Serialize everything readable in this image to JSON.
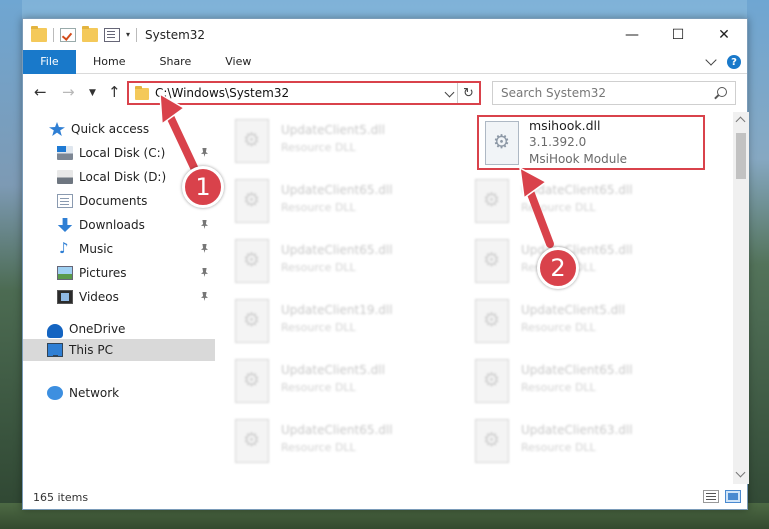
{
  "window": {
    "title": "System32",
    "controls": {
      "minimize": "—",
      "maximize": "☐",
      "close": "✕"
    }
  },
  "ribbon": {
    "tabs": [
      "File",
      "Home",
      "Share",
      "View"
    ]
  },
  "address": {
    "path": "C:\\Windows\\System32",
    "search_placeholder": "Search System32"
  },
  "nav": {
    "quick_access": "Quick access",
    "items": [
      {
        "label": "Local Disk (C:)",
        "icon": "local-disk-icon"
      },
      {
        "label": "Local Disk (D:)",
        "icon": "local-disk-icon"
      },
      {
        "label": "Documents",
        "icon": "documents-icon"
      },
      {
        "label": "Downloads",
        "icon": "downloads-icon"
      },
      {
        "label": "Music",
        "icon": "music-icon"
      },
      {
        "label": "Pictures",
        "icon": "pictures-icon"
      },
      {
        "label": "Videos",
        "icon": "videos-icon"
      }
    ],
    "onedrive": "OneDrive",
    "this_pc": "This PC",
    "network": "Network"
  },
  "files": {
    "left_column": [
      {
        "name": "UpdateClient5.dll",
        "type": "Resource DLL"
      },
      {
        "name": "UpdateClient65.dll",
        "type": "Resource DLL"
      },
      {
        "name": "UpdateClient65.dll",
        "type": "Resource DLL"
      },
      {
        "name": "UpdateClient19.dll",
        "type": "Resource DLL"
      },
      {
        "name": "UpdateClient5.dll",
        "type": "Resource DLL"
      },
      {
        "name": "UpdateClient65.dll",
        "type": "Resource DLL"
      }
    ],
    "right_column": [
      {
        "name": "UpdateClient65.dll",
        "type": "Resource DLL"
      },
      {
        "name": "UpdateClient65.dll",
        "type": "Resource DLL"
      },
      {
        "name": "UpdateClient5.dll",
        "type": "Resource DLL"
      },
      {
        "name": "UpdateClient65.dll",
        "type": "Resource DLL"
      },
      {
        "name": "UpdateClient63.dll",
        "type": "Resource DLL"
      }
    ],
    "highlighted": {
      "name": "msihook.dll",
      "version": "3.1.392.0",
      "description": "MsiHook Module"
    }
  },
  "status": {
    "items": "165 items"
  },
  "callouts": {
    "one": "1",
    "two": "2"
  },
  "colors": {
    "accent": "#1979ca",
    "callout": "#d9424b"
  }
}
